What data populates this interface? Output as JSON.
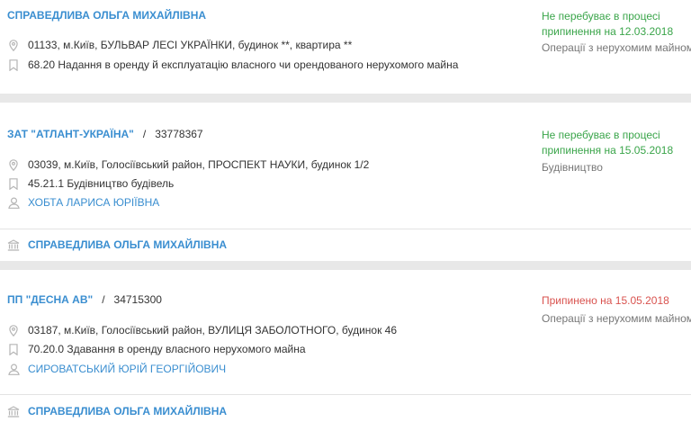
{
  "icons": {
    "location": "map-pin-icon",
    "activity": "bookmark-icon",
    "person": "user-icon",
    "founder": "bank-icon"
  },
  "colors": {
    "link": "#3a8ed0",
    "active_status": "#3aa54a",
    "terminated_status": "#d9534f",
    "separator": "#e8e8e8"
  },
  "records": [
    {
      "name": "СПРАВЕДЛИВА ОЛЬГА МИХАЙЛІВНА",
      "address": "01133, м.Київ, БУЛЬВАР ЛЕСІ УКРАЇНКИ, будинок **, квартира **",
      "activity": "68.20 Надання в оренду й експлуатацію власного чи орендованого нерухомого майна",
      "status": "Не перебуває в процесі припинення на 12.03.2018",
      "category": "Операції з нерухомим майном"
    },
    {
      "name": "ЗАТ \"АТЛАНТ-УКРАЇНА\"",
      "code": "33778367",
      "address": "03039, м.Київ, Голосіївський район, ПРОСПЕКТ НАУКИ, будинок 1/2",
      "activity": "45.21.1 Будівництво будівель",
      "director": "ХОБТА ЛАРИСА ЮРІЇВНА",
      "founder": "СПРАВЕДЛИВА ОЛЬГА МИХАЙЛІВНА",
      "status": "Не перебуває в процесі припинення на 15.05.2018",
      "category": "Будівництво"
    },
    {
      "name": "ПП \"ДЕСНА АВ\"",
      "code": "34715300",
      "address": "03187, м.Київ, Голосіївський район, ВУЛИЦЯ ЗАБОЛОТНОГО, будинок 46",
      "activity": "70.20.0 Здавання в оренду власного нерухомого майна",
      "director": "СИРОВАТСЬКИЙ ЮРІЙ ГЕОРГІЙОВИЧ",
      "founder": "СПРАВЕДЛИВА ОЛЬГА МИХАЙЛІВНА",
      "status": "Припинено на 15.05.2018",
      "category": "Операції з нерухомим майном"
    }
  ]
}
